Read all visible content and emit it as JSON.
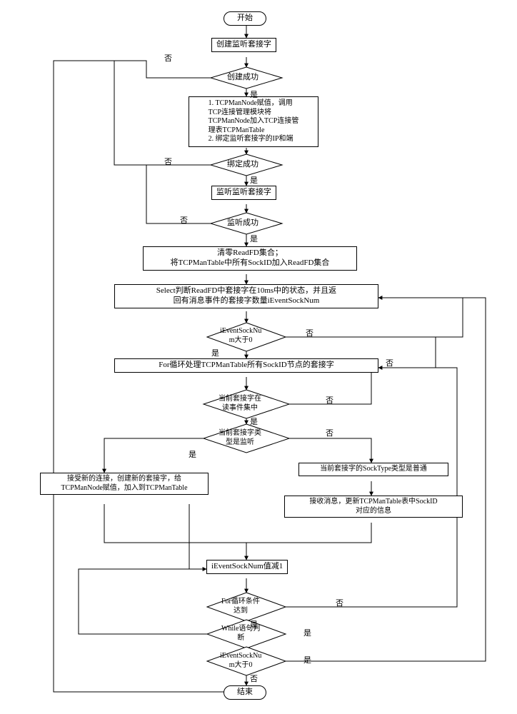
{
  "nodes": {
    "start": "开始",
    "create_socket": "创建监听套接字",
    "created_ok": "创建成功",
    "assign_bind": "1. TCPManNode赋值，调用\nTCP连接管理模块将\nTCPManNode加入TCP连接管\n理表TCPManTable\n2. 绑定监听套接字的IP和端",
    "bind_ok": "绑定成功",
    "listen_socket": "监听监听套接字",
    "listen_ok": "监听成功",
    "clear_readfd": "清零ReadFD集合；\n将TCPManTable中所有SockID加入ReadFD集合",
    "select_step": "Select判断ReadFD中套接字在10ms中的状态，并且返\n回有消息事件的套接字数量iEventSockNum",
    "evn_gt0": "iEventSockNu\nm大于0",
    "for_loop": "For循环处理TCPManTable所有SockID节点的套接字",
    "in_read_set": "当前套接字在\n读事件集中",
    "is_listen": "当前套接字类\n型是监听",
    "accept_new": "接受新的连接，创建新的套接字，给\nTCPManNode赋值，加入到TCPManTable",
    "socktype_normal": "当前套接字的SockType类型是普通",
    "recv_update": "接收消息，更新TCPManTable表中SockID\n对应的信息",
    "dec_evn": "iEventSockNum值减1",
    "for_cond": "For循环条件\n达到",
    "while_stmt": "While语句判\n断",
    "evn_gt0_2": "iEventSockNu\nm大于0",
    "end": "结束"
  },
  "labels": {
    "yes": "是",
    "no": "否"
  }
}
